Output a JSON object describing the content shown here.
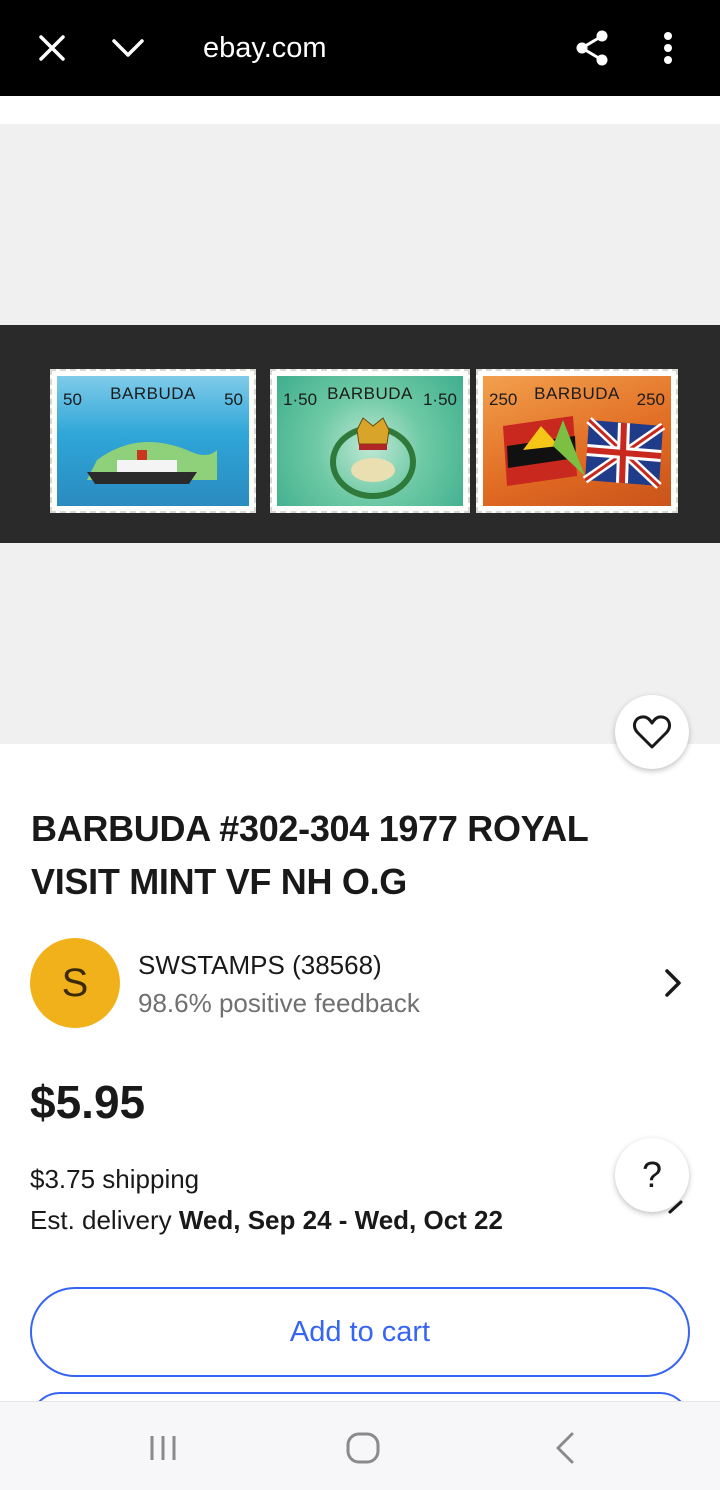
{
  "browser": {
    "url": "ebay.com",
    "icons": [
      "close-icon",
      "chevron-down-icon",
      "share-icon",
      "more-vert-icon"
    ]
  },
  "gallery": {
    "stamps": [
      {
        "country": "BARBUDA",
        "value": "50",
        "color": "#2fa6d8"
      },
      {
        "country": "BARBUDA",
        "value": "1·50",
        "color": "#4cb89a"
      },
      {
        "country": "BARBUDA",
        "value": "250",
        "color": "#e06a22"
      }
    ],
    "favorite_icon": "heart-outline-icon"
  },
  "listing": {
    "title": "BARBUDA #302-304 1977 ROYAL VISIT MINT VF NH O.G",
    "seller": {
      "initial": "S",
      "name": "SWSTAMPS (38568)",
      "feedback": "98.6% positive feedback",
      "avatar_color": "#f1b11a"
    },
    "price": "$5.95",
    "shipping": "$3.75 shipping",
    "delivery_prefix": "Est. delivery",
    "delivery_range": "Wed, Sep 24 - Wed, Oct 22",
    "help_label": "?",
    "add_to_cart": "Add to cart",
    "accent_color": "#3665f3"
  },
  "system_nav": {
    "icons": [
      "recent-apps-icon",
      "home-icon",
      "back-icon"
    ]
  }
}
